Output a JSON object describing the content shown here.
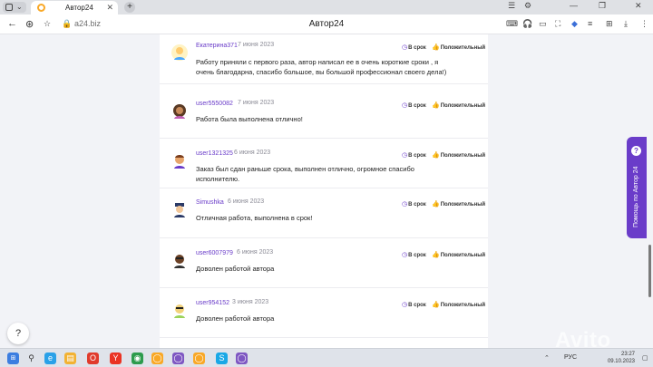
{
  "browser": {
    "tab_title": "Автор24",
    "tab_close": "✕",
    "newtab": "+",
    "url": "a24.biz",
    "page_title": "Автор24",
    "win_minimize": "—",
    "win_maximize": "❐",
    "win_close": "✕"
  },
  "reviews": [
    {
      "user": "Екатерина371",
      "date": "7 июня 2023",
      "ontime": "В срок",
      "rating": "Положительный",
      "text": "Работу приняли с первого раза, автор написал ее в очень короткие сроки , я очень благодарна, спасибо большое, вы большой профессионал своего дела!)"
    },
    {
      "user": "user5550082",
      "date": "7 июня 2023",
      "ontime": "В срок",
      "rating": "Положительный",
      "text": "Работа была выполнена отлично!"
    },
    {
      "user": "user1321325",
      "date": "6 июня 2023",
      "ontime": "В срок",
      "rating": "Положительный",
      "text": "Заказ был сдан раньше срока, выполнен отлично, огромное спасибо исполнителю."
    },
    {
      "user": "Simushka",
      "date": "6 июня 2023",
      "ontime": "В срок",
      "rating": "Положительный",
      "text": "Отличная работа, выполнена в срок!"
    },
    {
      "user": "user6007979",
      "date": "6 июня 2023",
      "ontime": "В срок",
      "rating": "Положительный",
      "text": "Доволен работой автора"
    },
    {
      "user": "user954152",
      "date": "3 июня 2023",
      "ontime": "В срок",
      "rating": "Положительный",
      "text": "Доволен работой автора"
    }
  ],
  "help_tab": {
    "icon": "?",
    "label": "Помощь по Автор 24"
  },
  "chat_button": "?",
  "taskbar": {
    "lang": "РУС",
    "time": "23:27",
    "date": "09.10.2023"
  },
  "watermark": "Avito",
  "colors": {
    "accent": "#6a3cc9",
    "taskbar": "#dfe3ea"
  }
}
